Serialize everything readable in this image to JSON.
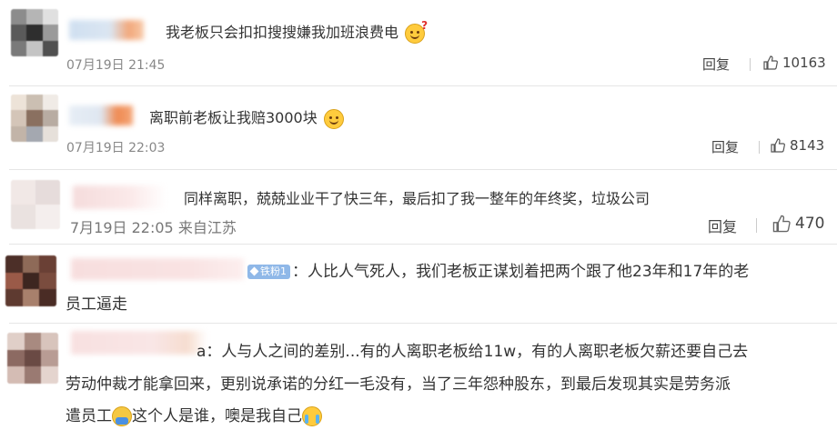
{
  "comments": [
    {
      "text": "我老板只会扣扣搜搜嫌我加班浪费电",
      "emoji": "thinking-face-emoji",
      "time": "07月19日 21:45",
      "reply": "回复",
      "likes": "10163"
    },
    {
      "text": "离职前老板让我赔3000块",
      "emoji": "smile-emoji",
      "time": "07月19日 22:03",
      "reply": "回复",
      "likes": "8143"
    },
    {
      "text": "同样离职，兢兢业业干了快三年，最后扣了我一整年的年终奖，垃圾公司",
      "time": "7月19日 22:05 来自江苏",
      "reply": "回复",
      "likes": "470"
    },
    {
      "badge": "铁粉1",
      "text_line1": "：人比人气死人，我们老板正谋划着把两个跟了他23年和17年的老",
      "text_line2": "员工逼走"
    },
    {
      "text_line1": "a：人与人之间的差别...有的人离职老板给11w，有的人离职老板欠薪还要自己去",
      "text_line2": "劳动仲裁才能拿回来，更别说承诺的分红一毛没有，当了三年怨种股东，到最后发现其实是劳务派",
      "text_line3a": "遣员工",
      "text_line3b": "这个人是谁，噢是我自己"
    }
  ]
}
